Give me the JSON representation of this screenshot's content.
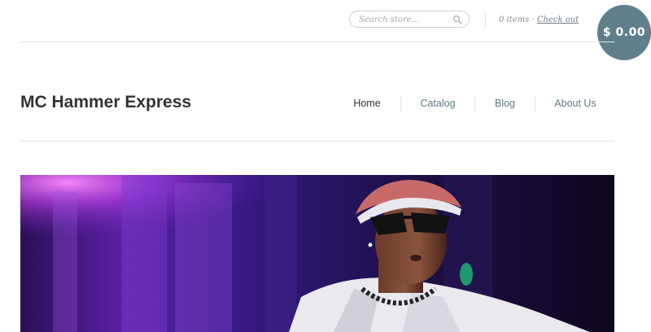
{
  "search": {
    "placeholder": "Search store..."
  },
  "cart": {
    "count_text": "0 items",
    "separator": " · ",
    "checkout_label": "Check out",
    "total": "$ 0.00"
  },
  "store": {
    "name": "MC Hammer Express"
  },
  "nav": {
    "items": [
      {
        "label": "Home",
        "active": true
      },
      {
        "label": "Catalog",
        "active": false
      },
      {
        "label": "Blog",
        "active": false
      },
      {
        "label": "About Us",
        "active": false
      }
    ]
  },
  "hero": {
    "image_alt": "MC Hammer performing on stage"
  },
  "colors": {
    "accent": "#607f8b",
    "link": "#5f7a85",
    "text": "#333333",
    "rule": "#e3e3e3"
  },
  "icons": {
    "search": "search-icon"
  }
}
